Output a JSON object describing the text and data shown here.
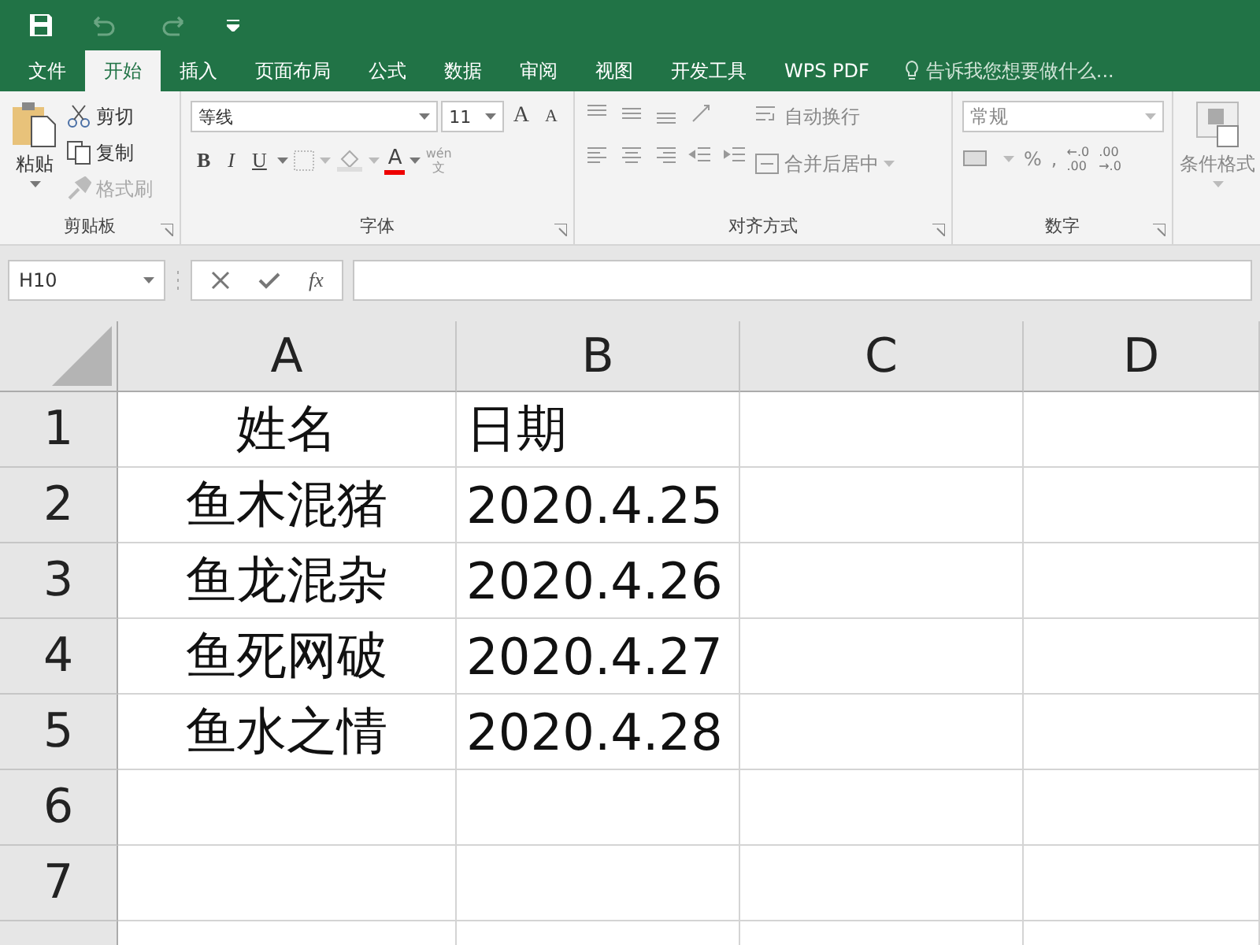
{
  "tabs": [
    {
      "label": "文件",
      "selected": false
    },
    {
      "label": "开始",
      "selected": true
    },
    {
      "label": "插入",
      "selected": false
    },
    {
      "label": "页面布局",
      "selected": false
    },
    {
      "label": "公式",
      "selected": false
    },
    {
      "label": "数据",
      "selected": false
    },
    {
      "label": "审阅",
      "selected": false
    },
    {
      "label": "视图",
      "selected": false
    },
    {
      "label": "开发工具",
      "selected": false
    },
    {
      "label": "WPS PDF",
      "selected": false
    }
  ],
  "tell_me": {
    "placeholder": "告诉我您想要做什么..."
  },
  "clipboard": {
    "label": "剪贴板",
    "paste": "粘贴",
    "items": [
      {
        "kind": "cut",
        "label": "剪切",
        "disabled": false
      },
      {
        "kind": "copy",
        "label": "复制",
        "disabled": false
      },
      {
        "kind": "painter",
        "label": "格式刷",
        "disabled": true
      }
    ]
  },
  "font": {
    "label": "字体",
    "font_name": "等线",
    "font_size": "11",
    "grow": "A",
    "shrink": "A",
    "bold": "B",
    "italic": "I",
    "underline": "U",
    "font_color": "A",
    "phonetic_top": "wén",
    "phonetic_bottom": "文"
  },
  "alignment": {
    "label": "对齐方式",
    "wrap": "自动换行",
    "merge": "合并后居中"
  },
  "number": {
    "label": "数字",
    "format": "常规",
    "percent": "%",
    "comma": ",",
    "decimals": [
      {
        "top": "←.0",
        "bottom": ".00"
      },
      {
        "top": ".00",
        "bottom": "→.0"
      }
    ]
  },
  "styles": {
    "conditional": "条件格式"
  },
  "formula_bar": {
    "name_box": "H10",
    "fx": "fx"
  },
  "sheet": {
    "columns": [
      "A",
      "B",
      "C",
      "D"
    ],
    "rows": [
      {
        "header": "1",
        "cells": [
          "姓名",
          "日期"
        ]
      },
      {
        "header": "2",
        "cells": [
          "鱼木混猪",
          "2020.4.25"
        ]
      },
      {
        "header": "3",
        "cells": [
          "鱼龙混杂",
          "2020.4.26"
        ]
      },
      {
        "header": "4",
        "cells": [
          "鱼死网破",
          "2020.4.27"
        ]
      },
      {
        "header": "5",
        "cells": [
          "鱼水之情",
          "2020.4.28"
        ]
      },
      {
        "header": "6",
        "cells": []
      },
      {
        "header": "7",
        "cells": []
      }
    ]
  }
}
